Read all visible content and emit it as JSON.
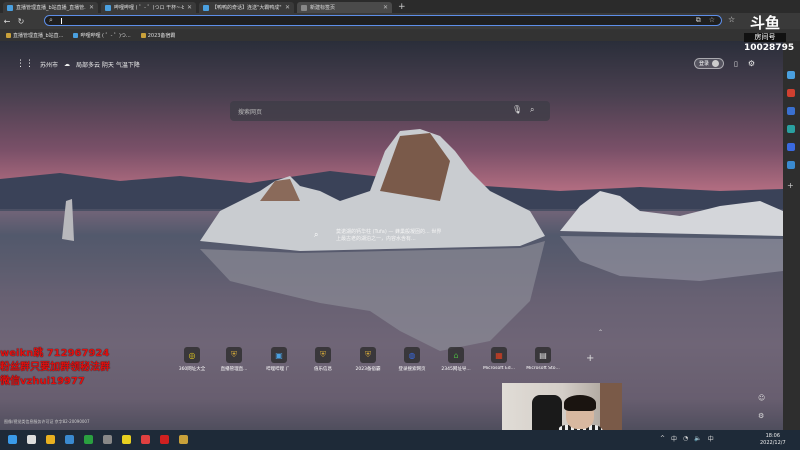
{
  "browser": {
    "tabs": [
      {
        "label": "直播管理直播_b站直播_直播管...",
        "color": "#4aa0e0",
        "active": false
      },
      {
        "label": "哔哩哔哩 ( ゜- ゜)つロ 干杯~-bili...",
        "color": "#4aa0e0",
        "active": false
      },
      {
        "label": "【鸭鸭的奇话】连送\"大霸鸭成\"...",
        "color": "#4aa0e0",
        "active": false
      },
      {
        "label": "新建标签页",
        "color": "#888888",
        "active": true
      }
    ],
    "new_tab_glyph": "+",
    "window_controls": [
      "—",
      "☐",
      "✕"
    ],
    "address_value": "",
    "bookmarks": [
      "直播管理直播_b站直...",
      "哔哩哔哩 ( ゜- ゜)つ...",
      "2023备宿霸"
    ]
  },
  "stream_overlay": {
    "logo": "斗鱼",
    "label": "房间号",
    "room_number": "10028795"
  },
  "ntp": {
    "location": "苏州市",
    "weather": "局部多云 阴天 气温下降",
    "login_label": "登录",
    "search_placeholder": "搜索网页",
    "caption": "莫诺湖的钙华柱 (Tufa) — 蜂巢般凝固的... 世界上最古老的湖泊之一，内容水含有...",
    "shortcuts": [
      {
        "label": "360网址大全",
        "icon": "360-icon",
        "color": "#e8d020"
      },
      {
        "label": "直播管理直...",
        "icon": "shield-icon",
        "color": "#c9a13a"
      },
      {
        "label": "哔哩哔哩 (゜",
        "icon": "tv-icon",
        "color": "#4aa0e0"
      },
      {
        "label": "值乐信息",
        "icon": "shield-icon",
        "color": "#c9a13a"
      },
      {
        "label": "2023备宿霸",
        "icon": "shield-icon",
        "color": "#c9a13a"
      },
      {
        "label": "登录搜索网页",
        "icon": "globe-icon",
        "color": "#3a6ae0"
      },
      {
        "label": "2345网址导...",
        "icon": "house-icon",
        "color": "#4ab040"
      },
      {
        "label": "Microsoft Ed...",
        "icon": "windows-icon",
        "color": "#e04020"
      },
      {
        "label": "Microsoft Sto...",
        "icon": "store-icon",
        "color": "#dddddd"
      }
    ],
    "add_shortcut": "+",
    "chevron": "⌃",
    "icp": "图像/视觉类信息服务许可证 京字82-20090007"
  },
  "promo": {
    "line1": "weikn跳 712967924",
    "line2": "粉丝群只要加群领秘法群",
    "line3": "微信vzhui19977"
  },
  "taskbar": {
    "clock_time": "18:06",
    "clock_date": "2022/12/7",
    "tray_items": [
      "^",
      "中",
      "中"
    ]
  }
}
